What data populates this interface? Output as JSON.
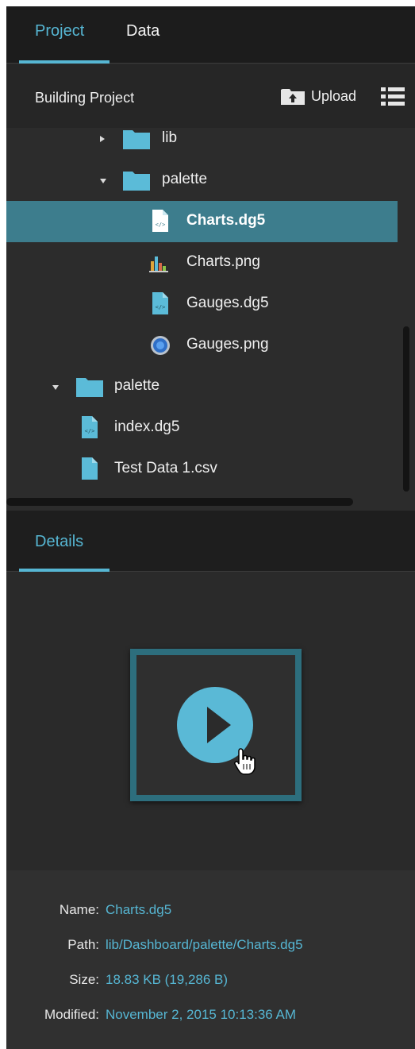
{
  "tabs": {
    "project": "Project",
    "data": "Data"
  },
  "project": {
    "title": "Building Project",
    "upload_label": "Upload"
  },
  "tree": [
    {
      "label": "lib",
      "type": "folder",
      "state": "collapsed"
    },
    {
      "label": "palette",
      "type": "folder",
      "state": "expanded"
    },
    {
      "label": "Charts.dg5",
      "type": "dg5",
      "selected": true
    },
    {
      "label": "Charts.png",
      "type": "image-chart"
    },
    {
      "label": "Gauges.dg5",
      "type": "dg5"
    },
    {
      "label": "Gauges.png",
      "type": "image-gauge"
    },
    {
      "label": "palette",
      "type": "folder",
      "state": "expanded"
    },
    {
      "label": "index.dg5",
      "type": "dg5"
    },
    {
      "label": "Test Data 1.csv",
      "type": "file"
    }
  ],
  "details": {
    "tab": "Details",
    "fields": {
      "name": {
        "label": "Name:",
        "value": "Charts.dg5"
      },
      "path": {
        "label": "Path:",
        "value": "lib/Dashboard/palette/Charts.dg5"
      },
      "size": {
        "label": "Size:",
        "value": "18.83 KB (19,286 B)"
      },
      "modified": {
        "label": "Modified:",
        "value": "November 2, 2015 10:13:36 AM"
      }
    }
  },
  "colors": {
    "accent": "#56b6d3",
    "selection": "#3d7d8d",
    "background": "#2a2a2a",
    "header": "#1c1c1c",
    "preview_frame": "#2d6e7d"
  }
}
